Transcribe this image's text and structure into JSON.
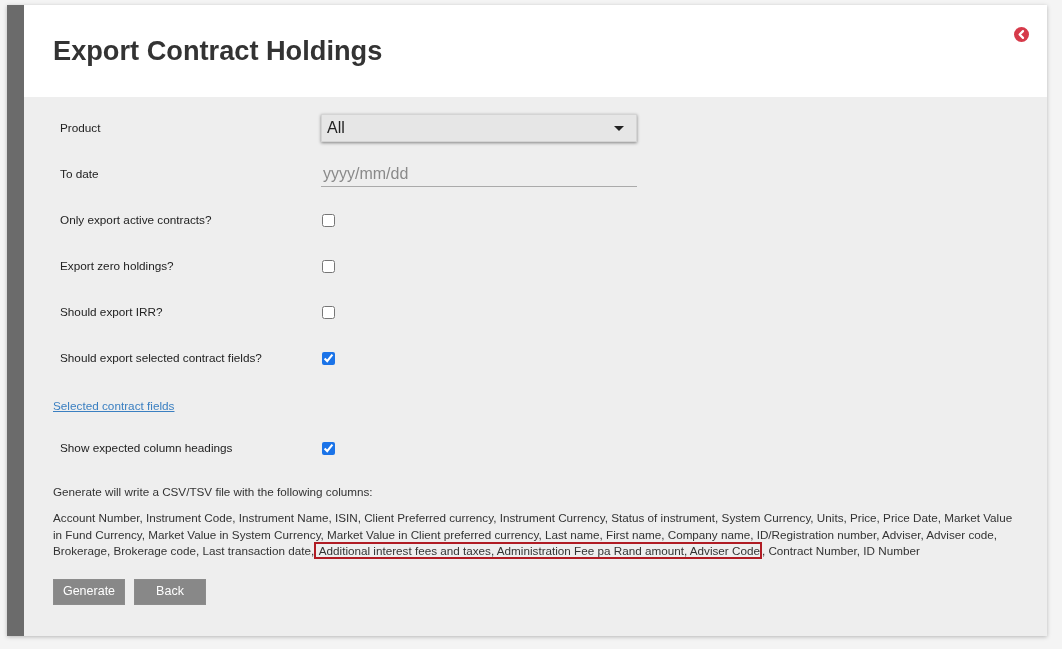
{
  "header": {
    "title": "Export Contract Holdings"
  },
  "form": {
    "fields": [
      {
        "kind": "select",
        "label": "Product",
        "value": "All"
      },
      {
        "kind": "date",
        "label": "To date",
        "placeholder": "yyyy/mm/dd"
      },
      {
        "kind": "checkbox",
        "label": "Only export active contracts?",
        "checked": false
      },
      {
        "kind": "checkbox",
        "label": "Export zero holdings?",
        "checked": false
      },
      {
        "kind": "checkbox",
        "label": "Should export IRR?",
        "checked": false
      },
      {
        "kind": "checkbox",
        "label": "Should export selected contract fields?",
        "checked": true
      },
      {
        "kind": "link",
        "label": "Selected contract fields"
      },
      {
        "kind": "checkbox",
        "label": "Show expected column headings",
        "checked": true
      }
    ]
  },
  "summary": {
    "intro": "Generate will write a CSV/TSV file with the following columns:",
    "columns": [
      {
        "text": "Account Number, Instrument Code, Instrument Name, ISIN, Client Preferred currency, Instrument Currency, Status of instrument, System Currency, Units, Price, Price Date, Market Value in Fund Currency, Market Value in System Currency, Market Value in Client preferred currency, Last name, First name, Company name, ID/Registration number, Adviser, Adviser code, Brokerage, Brokerage code, Last transaction date,",
        "highlighted": false
      },
      {
        "text": " Additional interest fees and taxes, Administration Fee pa Rand amount, Adviser Code",
        "highlighted": true
      },
      {
        "text": ", Contract Number, ID Number",
        "highlighted": false
      }
    ]
  },
  "buttons": [
    "Generate",
    "Back"
  ]
}
